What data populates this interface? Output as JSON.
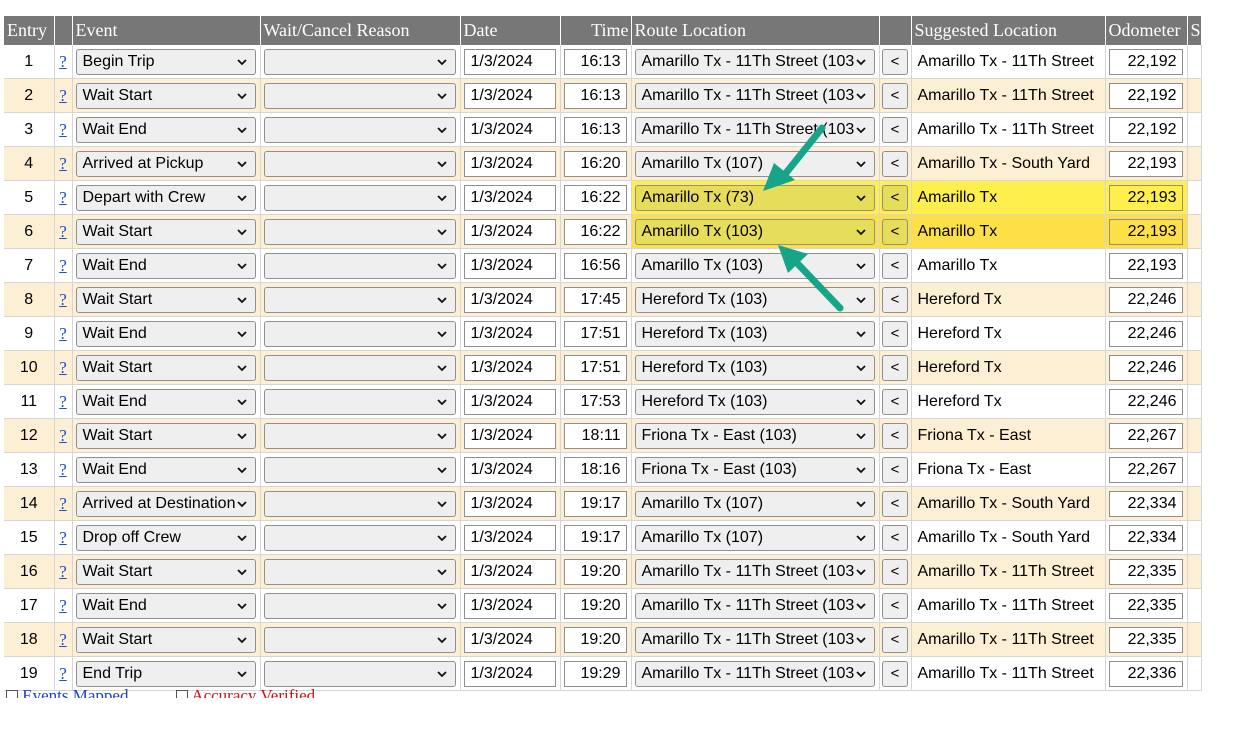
{
  "headers": [
    "Entry",
    "",
    "Event",
    "Wait/Cancel Reason",
    "Date",
    "Time",
    "Route Location",
    "",
    "Suggested Location",
    "Odometer",
    "S"
  ],
  "rows": [
    {
      "entry": "1",
      "help": "?",
      "event": "Begin Trip",
      "reason": "",
      "date": "1/3/2024",
      "time": "16:13",
      "route": "Amarillo Tx - 11Th Street (103",
      "btn": "<",
      "suggested": "Amarillo Tx - 11Th Street",
      "odometer": "22,192"
    },
    {
      "entry": "2",
      "help": "?",
      "event": "Wait Start",
      "reason": "",
      "date": "1/3/2024",
      "time": "16:13",
      "route": "Amarillo Tx - 11Th Street (103",
      "btn": "<",
      "suggested": "Amarillo Tx - 11Th Street",
      "odometer": "22,192"
    },
    {
      "entry": "3",
      "help": "?",
      "event": "Wait End",
      "reason": "",
      "date": "1/3/2024",
      "time": "16:13",
      "route": "Amarillo Tx - 11Th Street (103",
      "btn": "<",
      "suggested": "Amarillo Tx - 11Th Street",
      "odometer": "22,192"
    },
    {
      "entry": "4",
      "help": "?",
      "event": "Arrived at Pickup",
      "reason": "",
      "date": "1/3/2024",
      "time": "16:20",
      "route": "Amarillo Tx (107)",
      "btn": "<",
      "suggested": "Amarillo Tx - South Yard",
      "odometer": "22,193"
    },
    {
      "entry": "5",
      "help": "?",
      "event": "Depart with Crew",
      "reason": "",
      "date": "1/3/2024",
      "time": "16:22",
      "route": "Amarillo Tx (73)",
      "btn": "<",
      "suggested": "Amarillo Tx",
      "odometer": "22,193"
    },
    {
      "entry": "6",
      "help": "?",
      "event": "Wait Start",
      "reason": "",
      "date": "1/3/2024",
      "time": "16:22",
      "route": "Amarillo Tx (103)",
      "btn": "<",
      "suggested": "Amarillo Tx",
      "odometer": "22,193"
    },
    {
      "entry": "7",
      "help": "?",
      "event": "Wait End",
      "reason": "",
      "date": "1/3/2024",
      "time": "16:56",
      "route": "Amarillo Tx (103)",
      "btn": "<",
      "suggested": "Amarillo Tx",
      "odometer": "22,193"
    },
    {
      "entry": "8",
      "help": "?",
      "event": "Wait Start",
      "reason": "",
      "date": "1/3/2024",
      "time": "17:45",
      "route": "Hereford Tx (103)",
      "btn": "<",
      "suggested": "Hereford Tx",
      "odometer": "22,246"
    },
    {
      "entry": "9",
      "help": "?",
      "event": "Wait End",
      "reason": "",
      "date": "1/3/2024",
      "time": "17:51",
      "route": "Hereford Tx (103)",
      "btn": "<",
      "suggested": "Hereford Tx",
      "odometer": "22,246"
    },
    {
      "entry": "10",
      "help": "?",
      "event": "Wait Start",
      "reason": "",
      "date": "1/3/2024",
      "time": "17:51",
      "route": "Hereford Tx (103)",
      "btn": "<",
      "suggested": "Hereford Tx",
      "odometer": "22,246"
    },
    {
      "entry": "11",
      "help": "?",
      "event": "Wait End",
      "reason": "",
      "date": "1/3/2024",
      "time": "17:53",
      "route": "Hereford Tx (103)",
      "btn": "<",
      "suggested": "Hereford Tx",
      "odometer": "22,246"
    },
    {
      "entry": "12",
      "help": "?",
      "event": "Wait Start",
      "reason": "",
      "date": "1/3/2024",
      "time": "18:11",
      "route": "Friona Tx - East (103)",
      "btn": "<",
      "suggested": "Friona Tx - East",
      "odometer": "22,267"
    },
    {
      "entry": "13",
      "help": "?",
      "event": "Wait End",
      "reason": "",
      "date": "1/3/2024",
      "time": "18:16",
      "route": "Friona Tx - East (103)",
      "btn": "<",
      "suggested": "Friona Tx - East",
      "odometer": "22,267"
    },
    {
      "entry": "14",
      "help": "?",
      "event": "Arrived at Destination",
      "reason": "",
      "date": "1/3/2024",
      "time": "19:17",
      "route": "Amarillo Tx (107)",
      "btn": "<",
      "suggested": "Amarillo Tx - South Yard",
      "odometer": "22,334"
    },
    {
      "entry": "15",
      "help": "?",
      "event": "Drop off Crew",
      "reason": "",
      "date": "1/3/2024",
      "time": "19:17",
      "route": "Amarillo Tx (107)",
      "btn": "<",
      "suggested": "Amarillo Tx - South Yard",
      "odometer": "22,334"
    },
    {
      "entry": "16",
      "help": "?",
      "event": "Wait Start",
      "reason": "",
      "date": "1/3/2024",
      "time": "19:20",
      "route": "Amarillo Tx - 11Th Street (103",
      "btn": "<",
      "suggested": "Amarillo Tx - 11Th Street",
      "odometer": "22,335"
    },
    {
      "entry": "17",
      "help": "?",
      "event": "Wait End",
      "reason": "",
      "date": "1/3/2024",
      "time": "19:20",
      "route": "Amarillo Tx - 11Th Street (103",
      "btn": "<",
      "suggested": "Amarillo Tx - 11Th Street",
      "odometer": "22,335"
    },
    {
      "entry": "18",
      "help": "?",
      "event": "Wait Start",
      "reason": "",
      "date": "1/3/2024",
      "time": "19:20",
      "route": "Amarillo Tx - 11Th Street (103",
      "btn": "<",
      "suggested": "Amarillo Tx - 11Th Street",
      "odometer": "22,335"
    },
    {
      "entry": "19",
      "help": "?",
      "event": "End Trip",
      "reason": "",
      "date": "1/3/2024",
      "time": "19:29",
      "route": "Amarillo Tx - 11Th Street (103",
      "btn": "<",
      "suggested": "Amarillo Tx - 11Th Street",
      "odometer": "22,336"
    }
  ],
  "highlighted_rows": [
    5,
    6
  ],
  "footer": {
    "events_mapped": "Events Mapped",
    "accuracy_verified": "Accuracy Verified"
  },
  "colors": {
    "header_bg": "#777777",
    "alt_row": "#fcefd3",
    "highlight": "#ffef4d",
    "annotation_arrow": "#17a589",
    "link": "#1a4fd1"
  },
  "icons": {
    "dropdown": "chevron-down-icon",
    "annotation": "arrow-icon"
  }
}
